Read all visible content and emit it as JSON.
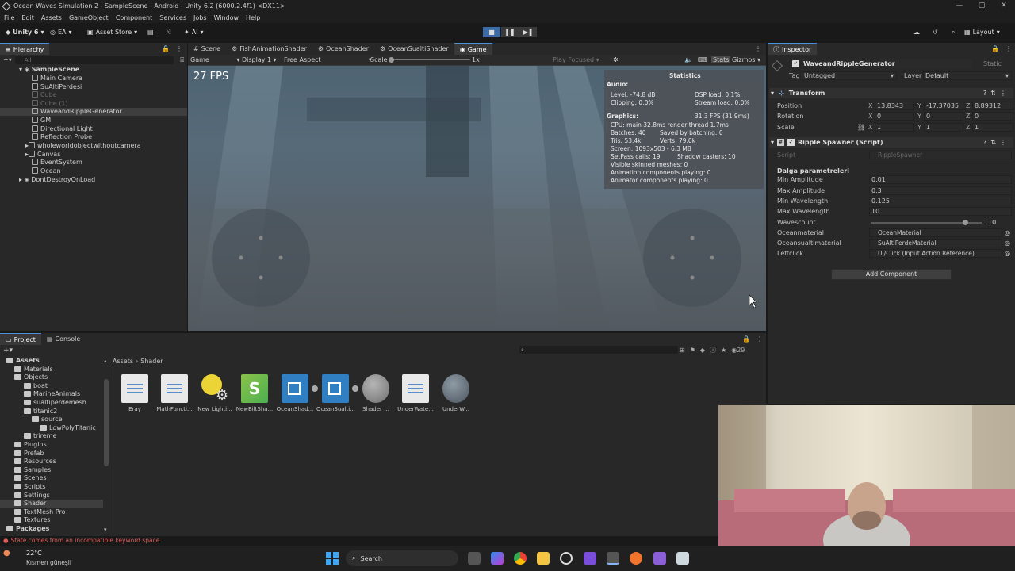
{
  "window": {
    "title": "Ocean Waves Simulation 2 - SampleScene - Android - Unity 6.2 (6000.2.4f1) <DX11>"
  },
  "menu": [
    "File",
    "Edit",
    "Assets",
    "GameObject",
    "Component",
    "Services",
    "Jobs",
    "Window",
    "Help"
  ],
  "toolbar": {
    "unity": "Unity 6",
    "account": "EA",
    "asset_store": "Asset Store",
    "ai": "AI",
    "layout": "Layout"
  },
  "hierarchy": {
    "title": "Hierarchy",
    "search_placeholder": "All",
    "scene": "SampleScene",
    "items": [
      {
        "name": "Main Camera",
        "dim": false
      },
      {
        "name": "SuAltiPerdesi",
        "dim": false
      },
      {
        "name": "Cube",
        "dim": true
      },
      {
        "name": "Cube (1)",
        "dim": true
      },
      {
        "name": "WaveandRippleGenerator",
        "dim": false
      },
      {
        "name": "GM",
        "dim": false
      },
      {
        "name": "Directional Light",
        "dim": false
      },
      {
        "name": "Reflection Probe",
        "dim": false
      },
      {
        "name": "wholeworldobjectwithoutcamera",
        "dim": false
      },
      {
        "name": "Canvas",
        "dim": false
      },
      {
        "name": "EventSystem",
        "dim": false
      },
      {
        "name": "Ocean",
        "dim": false
      }
    ],
    "dontdestroy": "DontDestroyOnLoad"
  },
  "scene_tabs": [
    "Scene",
    "FishAnimationShader",
    "OceanShader",
    "OceanSualtiShader",
    "Game"
  ],
  "game_toolbar": {
    "mode": "Game",
    "display": "Display 1",
    "aspect": "Free Aspect",
    "scale_label": "Scale",
    "scale_value": "1x",
    "play_focused": "Play Focused",
    "stats": "Stats",
    "gizmos": "Gizmos"
  },
  "game": {
    "fps": "27 FPS"
  },
  "stats": {
    "title": "Statistics",
    "audio": "Audio:",
    "level": "Level: -74.8 dB",
    "clipping": "Clipping: 0.0%",
    "dsp": "DSP load: 0.1%",
    "stream": "Stream load: 0.0%",
    "graphics": "Graphics:",
    "fps": "31.3 FPS (31.9ms)",
    "cpu": "CPU: main 32.8ms  render thread 1.7ms",
    "batches": "Batches: 40",
    "saved": "Saved by batching: 0",
    "tris": "Tris: 53.4k",
    "verts": "Verts: 79.0k",
    "screen": "Screen: 1093x503 - 6.3 MB",
    "setpass": "SetPass calls: 19",
    "shadow": "Shadow casters: 10",
    "skinned": "Visible skinned meshes: 0",
    "anim": "Animation components playing: 0",
    "animator": "Animator components playing: 0"
  },
  "inspector": {
    "title": "Inspector",
    "object": "WaveandRippleGenerator",
    "static": "Static",
    "tag_label": "Tag",
    "tag": "Untagged",
    "layer_label": "Layer",
    "layer": "Default",
    "transform": {
      "title": "Transform",
      "position_label": "Position",
      "rotation_label": "Rotation",
      "scale_label": "Scale",
      "position": [
        "13.8343",
        "-17.37035",
        "8.89312"
      ],
      "rotation": [
        "0",
        "0",
        "0"
      ],
      "scale": [
        "1",
        "1",
        "1"
      ]
    },
    "script": {
      "title": "Ripple Spawner (Script)",
      "script_label": "Script",
      "script_value": "RippleSpawner",
      "section": "Dalga parametreleri",
      "fields": [
        {
          "label": "Min Amplitude",
          "value": "0.01"
        },
        {
          "label": "Max Amplitude",
          "value": "0.3"
        },
        {
          "label": "Min Wavelength",
          "value": "0.125"
        },
        {
          "label": "Max Wavelength",
          "value": "10"
        }
      ],
      "wavescount_label": "Wavescount",
      "wavescount": "10",
      "wavescount_fraction": 0.85,
      "refs": [
        {
          "label": "Oceanmaterial",
          "value": "OceanMaterial"
        },
        {
          "label": "Oceansualtimaterial",
          "value": "SuAltiPerdeMaterial"
        },
        {
          "label": "Leftclick",
          "value": "UI/Click (Input Action Reference)"
        }
      ]
    },
    "add_component": "Add Component"
  },
  "project": {
    "tabs": [
      "Project",
      "Console"
    ],
    "breadcrumb": [
      "Assets",
      "Shader"
    ],
    "count": "29",
    "tree": [
      {
        "t": "Assets",
        "d": 0
      },
      {
        "t": "Materials",
        "d": 1
      },
      {
        "t": "Objects",
        "d": 1
      },
      {
        "t": "boat",
        "d": 2
      },
      {
        "t": "MarineAnimals",
        "d": 2
      },
      {
        "t": "sualtiperdemesh",
        "d": 2
      },
      {
        "t": "titanic2",
        "d": 2
      },
      {
        "t": "source",
        "d": 3
      },
      {
        "t": "LowPolyTitanic",
        "d": 4
      },
      {
        "t": "trireme",
        "d": 2
      },
      {
        "t": "Plugins",
        "d": 1
      },
      {
        "t": "Prefab",
        "d": 1
      },
      {
        "t": "Resources",
        "d": 1
      },
      {
        "t": "Samples",
        "d": 1
      },
      {
        "t": "Scenes",
        "d": 1
      },
      {
        "t": "Scripts",
        "d": 1
      },
      {
        "t": "Settings",
        "d": 1
      },
      {
        "t": "Shader",
        "d": 1
      },
      {
        "t": "TextMesh Pro",
        "d": 1
      },
      {
        "t": "Textures",
        "d": 1
      },
      {
        "t": "Packages",
        "d": 0
      }
    ],
    "assets": [
      "Eray",
      "MathFuncti...",
      "New Lighti...",
      "NewBiltSha...",
      "OceanShad...",
      "OceanSualti...",
      "Shader ...",
      "UnderWate...",
      "UnderW..."
    ]
  },
  "status": {
    "message": "State comes from an incompatible keyword space"
  },
  "taskbar": {
    "temp": "22°C",
    "weather": "Kısmen güneşli",
    "search": "Search"
  }
}
